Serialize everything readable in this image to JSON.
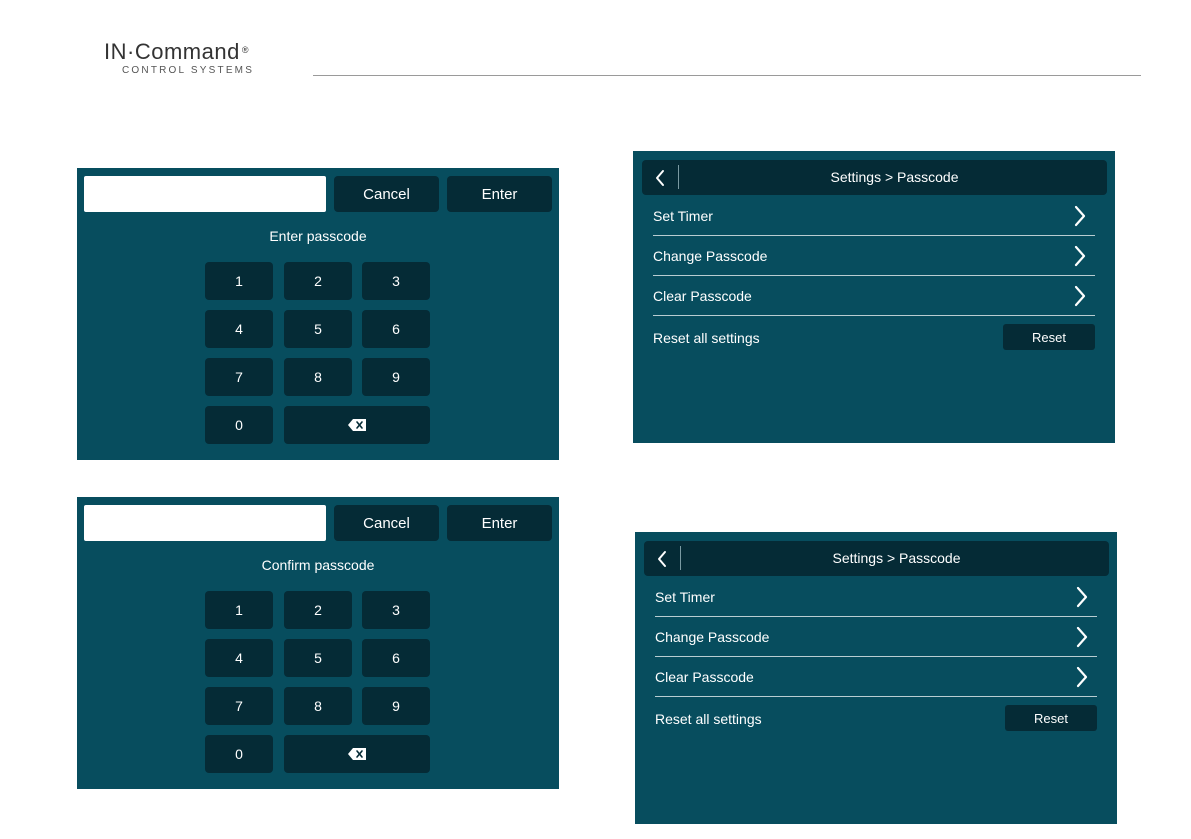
{
  "brand": {
    "name": "IN·Command",
    "registered": "®",
    "subtitle": "CONTROL SYSTEMS"
  },
  "keypads": [
    {
      "display_value": "",
      "cancel_label": "Cancel",
      "enter_label": "Enter",
      "prompt": "Enter passcode",
      "keys": [
        "1",
        "2",
        "3",
        "4",
        "5",
        "6",
        "7",
        "8",
        "9",
        "0"
      ],
      "backspace_icon": "backspace-icon"
    },
    {
      "display_value": "",
      "cancel_label": "Cancel",
      "enter_label": "Enter",
      "prompt": "Confirm passcode",
      "keys": [
        "1",
        "2",
        "3",
        "4",
        "5",
        "6",
        "7",
        "8",
        "9",
        "0"
      ],
      "backspace_icon": "backspace-icon"
    }
  ],
  "settings": [
    {
      "title": "Settings > Passcode",
      "back_icon": "chevron-left-icon",
      "items": [
        {
          "label": "Set Timer",
          "icon": "chevron-right-icon"
        },
        {
          "label": "Change Passcode",
          "icon": "chevron-right-icon"
        },
        {
          "label": "Clear Passcode",
          "icon": "chevron-right-icon"
        }
      ],
      "reset_label": "Reset all settings",
      "reset_button": "Reset"
    },
    {
      "title": "Settings > Passcode",
      "back_icon": "chevron-left-icon",
      "items": [
        {
          "label": "Set Timer",
          "icon": "chevron-right-icon"
        },
        {
          "label": "Change Passcode",
          "icon": "chevron-right-icon"
        },
        {
          "label": "Clear Passcode",
          "icon": "chevron-right-icon"
        }
      ],
      "reset_label": "Reset all settings",
      "reset_button": "Reset"
    }
  ],
  "colors": {
    "panel_bg": "#074d5e",
    "button_bg": "#052b36",
    "text": "#ffffff"
  }
}
